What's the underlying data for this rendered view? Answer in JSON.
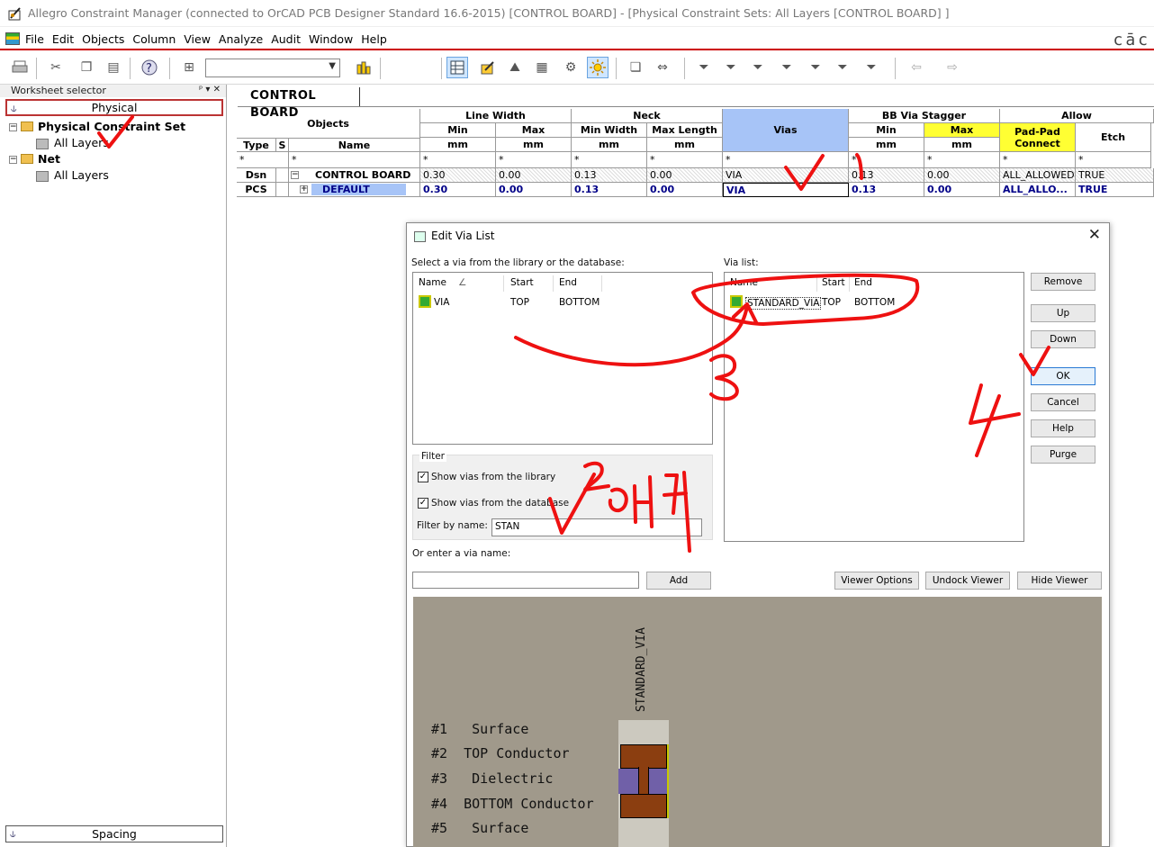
{
  "window": {
    "title": "Allegro Constraint Manager (connected to OrCAD PCB Designer Standard 16.6-2015) [CONTROL BOARD] - [Physical Constraint Sets:  All Layers [CONTROL BOARD] ]"
  },
  "menu": [
    "File",
    "Edit",
    "Objects",
    "Column",
    "View",
    "Analyze",
    "Audit",
    "Window",
    "Help"
  ],
  "brand_fragment": "cāc",
  "sidebar": {
    "header": "Worksheet selector",
    "header_buttons": "ᵖ ▾ ✕",
    "physical_tab": "Physical",
    "tree": [
      {
        "label": "Physical Constraint Set",
        "expander": "−"
      },
      {
        "label": "All Layers"
      },
      {
        "label": "Net",
        "expander": "−"
      },
      {
        "label": "All Layers"
      }
    ],
    "spacing_tab": "Spacing"
  },
  "document_tab": "CONTROL BOARD",
  "grid": {
    "objects": "Objects",
    "line_width": "Line Width",
    "neck": "Neck",
    "vias": "Vias",
    "bb_via_stagger": "BB Via Stagger",
    "allow": "Allow",
    "min": "Min",
    "max": "Max",
    "min_width": "Min Width",
    "max_length": "Max Length",
    "pad_pad_connect": "Pad-Pad Connect",
    "etch": "Etch",
    "type": "Type",
    "s": "S",
    "name": "Name",
    "unit": "mm",
    "wildcard": "*",
    "rows": [
      {
        "type": "Dsn",
        "expander": "−",
        "name": "CONTROL BOARD",
        "lw_min": "0.30",
        "lw_max": "0.00",
        "neck_min": "0.13",
        "neck_max": "0.00",
        "vias": "VIA",
        "bb_min": "0.13",
        "bb_max": "0.00",
        "padpad": "ALL_ALLOWED",
        "etch": "TRUE"
      },
      {
        "type": "PCS",
        "expander": "+",
        "name": "DEFAULT",
        "lw_min": "0.30",
        "lw_max": "0.00",
        "neck_min": "0.13",
        "neck_max": "0.00",
        "vias": "VIA",
        "bb_min": "0.13",
        "bb_max": "0.00",
        "padpad": "ALL_ALLO...",
        "etch": "TRUE"
      }
    ]
  },
  "dialog": {
    "title": "Edit Via List",
    "close": "✕",
    "select_label": "Select a via from the library or the database:",
    "via_list_label": "Via list:",
    "col_name": "Name",
    "sort_glyph": "∠",
    "col_start": "Start",
    "col_end": "End",
    "library": [
      {
        "name": "VIA",
        "start": "TOP",
        "end": "BOTTOM"
      }
    ],
    "selected": [
      {
        "name": "STANDARD_VIA",
        "start": "TOP",
        "end": "BOTTOM"
      }
    ],
    "buttons": {
      "remove": "Remove",
      "up": "Up",
      "down": "Down",
      "ok": "OK",
      "cancel": "Cancel",
      "help": "Help",
      "purge": "Purge"
    },
    "filter": {
      "title": "Filter",
      "show_library": "Show vias from the library",
      "show_database": "Show vias from the database",
      "filter_by_name": "Filter by name:",
      "filter_value": "STAN",
      "check": "✓"
    },
    "enter_via_label": "Or enter a via name:",
    "enter_via_value": "",
    "add": "Add",
    "viewer_buttons": {
      "options": "Viewer Options",
      "undock": "Undock Viewer",
      "hide": "Hide Viewer"
    },
    "viewer": {
      "via_name": "STANDARD_VIA",
      "layers": [
        {
          "num": "#1",
          "name": "Surface"
        },
        {
          "num": "#2",
          "name": "TOP Conductor"
        },
        {
          "num": "#3",
          "name": "Dielectric"
        },
        {
          "num": "#4",
          "name": "BOTTOM Conductor"
        },
        {
          "num": "#5",
          "name": "Surface"
        }
      ]
    }
  },
  "annotations": {
    "n1": "1",
    "n2": "2",
    "n3": "3",
    "n4": "4",
    "korean": "입력"
  },
  "colors": {
    "annotation": "#ee1111",
    "highlight_blue": "#a7c4f7",
    "highlight_yellow": "#ffff33",
    "viewer_bg": "#a0998b"
  }
}
